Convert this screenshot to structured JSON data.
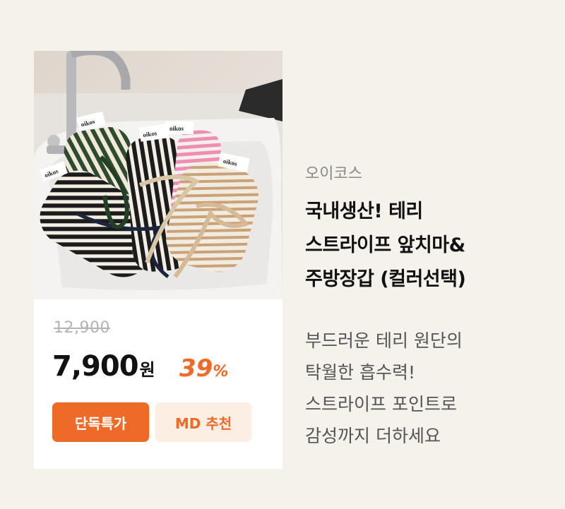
{
  "product": {
    "brand": "오이코스",
    "title_lines": [
      "국내생산! 테리",
      "스트라이프 앞치마&",
      "주방장갑 (컬러선택)"
    ],
    "original_price": "12,900",
    "price": "7,900",
    "currency": "원",
    "discount": "39",
    "discount_unit": "%",
    "badges": [
      "단독특가",
      "MD 추천"
    ],
    "description_lines": [
      "부드러운 테리 원단의",
      "탁월한 흡수력!",
      "스트라이프 포인트로",
      "감성까지 더하세요"
    ],
    "image_label": "oikos"
  },
  "colors": {
    "background": "#f5f1eb",
    "accent": "#ee6a28",
    "badge_light": "#fdeee4",
    "stripe_green": "#2f4a2c",
    "stripe_black": "#1c1c1c",
    "stripe_pink": "#ec8fb0",
    "stripe_beige": "#c9a27a"
  }
}
